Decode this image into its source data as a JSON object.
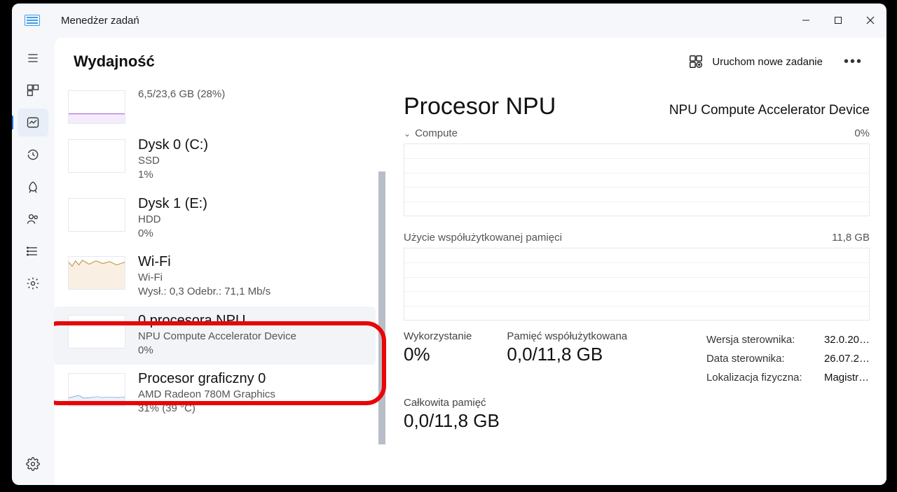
{
  "app_title": "Menedżer zadań",
  "page_title": "Wydajność",
  "run_task_label": "Uruchom nowe zadanie",
  "sidebar": {
    "items": [
      {
        "title": "",
        "sub1": "6,5/23,6 GB (28%)",
        "sub2": ""
      },
      {
        "title": "Dysk 0 (C:)",
        "sub1": "SSD",
        "sub2": "1%"
      },
      {
        "title": "Dysk 1 (E:)",
        "sub1": "HDD",
        "sub2": "0%"
      },
      {
        "title": "Wi-Fi",
        "sub1": "Wi-Fi",
        "sub2": "Wysł.: 0,3 Odebr.: 71,1 Mb/s"
      },
      {
        "title": "0 procesora NPU",
        "sub1": "NPU Compute Accelerator Device",
        "sub2": "0%"
      },
      {
        "title": "Procesor graficzny 0",
        "sub1": "AMD Radeon 780M Graphics",
        "sub2": "31%  (39 °C)"
      }
    ]
  },
  "detail": {
    "title": "Procesor NPU",
    "subtitle": "NPU Compute Accelerator Device",
    "compute_label": "Compute",
    "compute_value": "0%",
    "shared_mem_label": "Użycie współużytkowanej pamięci",
    "shared_mem_total": "11,8 GB",
    "util_label": "Wykorzystanie",
    "util_value": "0%",
    "shared_label": "Pamięć współużytkowana",
    "shared_value": "0,0/11,8 GB",
    "total_label": "Całkowita pamięć",
    "total_value": "0,0/11,8 GB",
    "driver_version_label": "Wersja sterownika:",
    "driver_version_value": "32.0.20…",
    "driver_date_label": "Data sterownika:",
    "driver_date_value": "26.07.2…",
    "phys_loc_label": "Lokalizacja fizyczna:",
    "phys_loc_value": "Magistr…"
  }
}
